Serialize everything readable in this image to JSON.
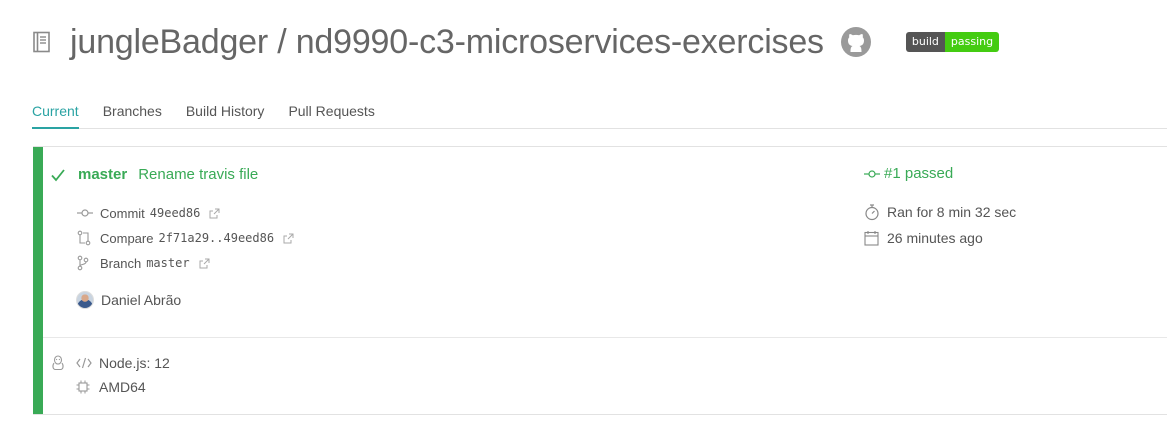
{
  "repo": {
    "title": "jungleBadger / nd9990-c3-microservices-exercises",
    "badge_left": "build",
    "badge_right": "passing"
  },
  "tabs": [
    {
      "label": "Current",
      "active": true
    },
    {
      "label": "Branches",
      "active": false
    },
    {
      "label": "Build History",
      "active": false
    },
    {
      "label": "Pull Requests",
      "active": false
    }
  ],
  "build": {
    "branch": "master",
    "message": "Rename travis file",
    "status": "#1 passed",
    "commit_label": "Commit",
    "commit_hash": "49eed86",
    "compare_label": "Compare",
    "compare_range": "2f71a29..49eed86",
    "branch_label": "Branch",
    "branch_code": "master",
    "author": "Daniel Abrão",
    "duration": "Ran for 8 min 32 sec",
    "finished": "26 minutes ago",
    "language": "Node.js: 12",
    "arch": "AMD64"
  },
  "colors": {
    "passed": "#39aa56",
    "accent": "#2aa3a3",
    "badge_pass": "#44cc11"
  },
  "icons": [
    "repo-icon",
    "github-icon",
    "check-icon",
    "commit-icon",
    "compare-icon",
    "branch-icon",
    "external-link-icon",
    "stopwatch-icon",
    "calendar-icon",
    "linux-icon",
    "code-icon",
    "cpu-icon"
  ]
}
